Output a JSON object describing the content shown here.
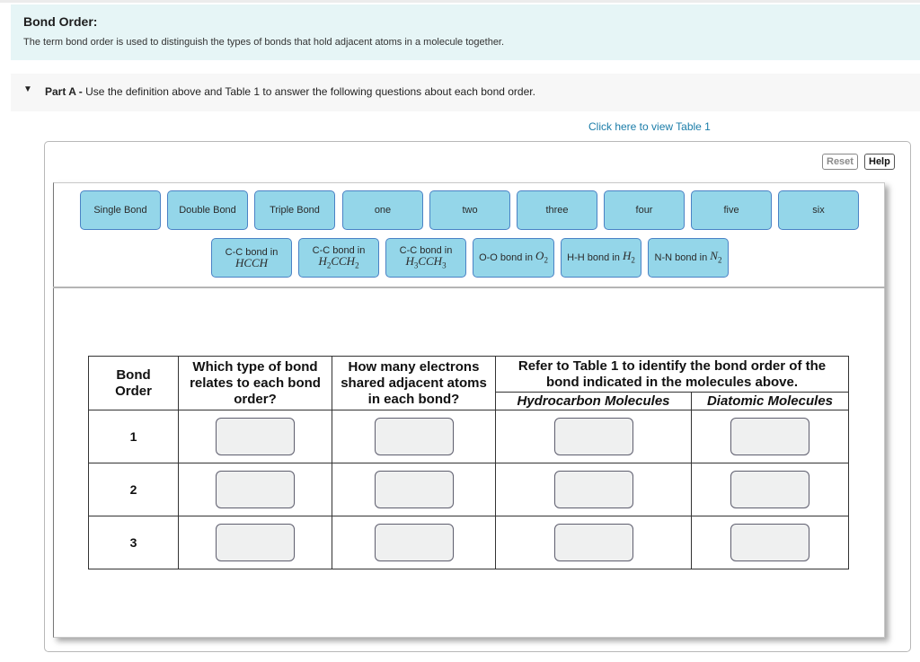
{
  "intro": {
    "title": "Bond Order:",
    "text": "The term bond order is used to distinguish the types of bonds that hold adjacent atoms in a molecule together."
  },
  "part_a": {
    "arrow_icon": "caret-down-icon",
    "label": "Part A -",
    "prompt": "Use the definition above and Table 1 to answer the following questions about each bond order."
  },
  "table_link": "Click here to view Table 1",
  "toolbar": {
    "reset": "Reset",
    "help": "Help"
  },
  "chips_row1": [
    {
      "label": "Single Bond"
    },
    {
      "label": "Double Bond"
    },
    {
      "label": "Triple Bond"
    },
    {
      "label": "one"
    },
    {
      "label": "two"
    },
    {
      "label": "three"
    },
    {
      "label": "four"
    },
    {
      "label": "five"
    },
    {
      "label": "six"
    }
  ],
  "chips_row2": [
    {
      "prefix": "C-C bond in",
      "formula": [
        "H",
        "C",
        "C",
        "H"
      ],
      "subs": [
        "",
        "",
        "",
        ""
      ]
    },
    {
      "prefix": "C-C bond in",
      "formula": [
        "H",
        "C",
        "C",
        "H"
      ],
      "subs": [
        "2",
        "",
        "",
        "2"
      ]
    },
    {
      "prefix": "C-C bond in",
      "formula": [
        "H",
        "C",
        "C",
        "H"
      ],
      "subs": [
        "3",
        "",
        "",
        "3"
      ]
    },
    {
      "prefix": "O-O bond in",
      "formula": [
        "O"
      ],
      "subs": [
        "2"
      ]
    },
    {
      "prefix": "H-H bond in",
      "formula": [
        "H"
      ],
      "subs": [
        "2"
      ]
    },
    {
      "prefix": "N-N bond in",
      "formula": [
        "N"
      ],
      "subs": [
        "2"
      ]
    }
  ],
  "grid": {
    "headers": {
      "bond_order": "Bond Order",
      "type": "Which type of bond relates to each bond order?",
      "electrons": "How many electrons shared adjacent atoms in each bond?",
      "refer": "Refer to Table 1 to identify the bond order of the bond indicated in the molecules above.",
      "hydrocarbon": "Hydrocarbon Molecules",
      "diatomic": "Diatomic Molecules"
    },
    "rows": [
      {
        "order": "1"
      },
      {
        "order": "2"
      },
      {
        "order": "3"
      }
    ]
  }
}
